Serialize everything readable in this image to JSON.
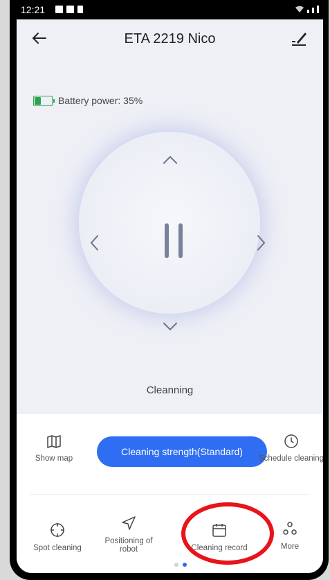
{
  "status_bar": {
    "time": "12:21"
  },
  "header": {
    "title": "ETA 2219 Nico",
    "back_icon": "arrow-left-icon",
    "edit_icon": "pencil-icon"
  },
  "battery": {
    "label": "Battery power: 35%",
    "level": 0.35,
    "color": "#2ea44f"
  },
  "control": {
    "state_label": "Cleanning"
  },
  "tools_row1": {
    "show_map": "Show map",
    "strength": "Cleaning strength(Standard)",
    "schedule": "Schedule cleaning"
  },
  "tools_row2": {
    "spot": "Spot cleaning",
    "positioning": "Positioning of robot",
    "record": "Cleaning record",
    "more": "More"
  },
  "accent": "#2f6df2",
  "page_indicator": {
    "count": 2,
    "active": 1
  }
}
